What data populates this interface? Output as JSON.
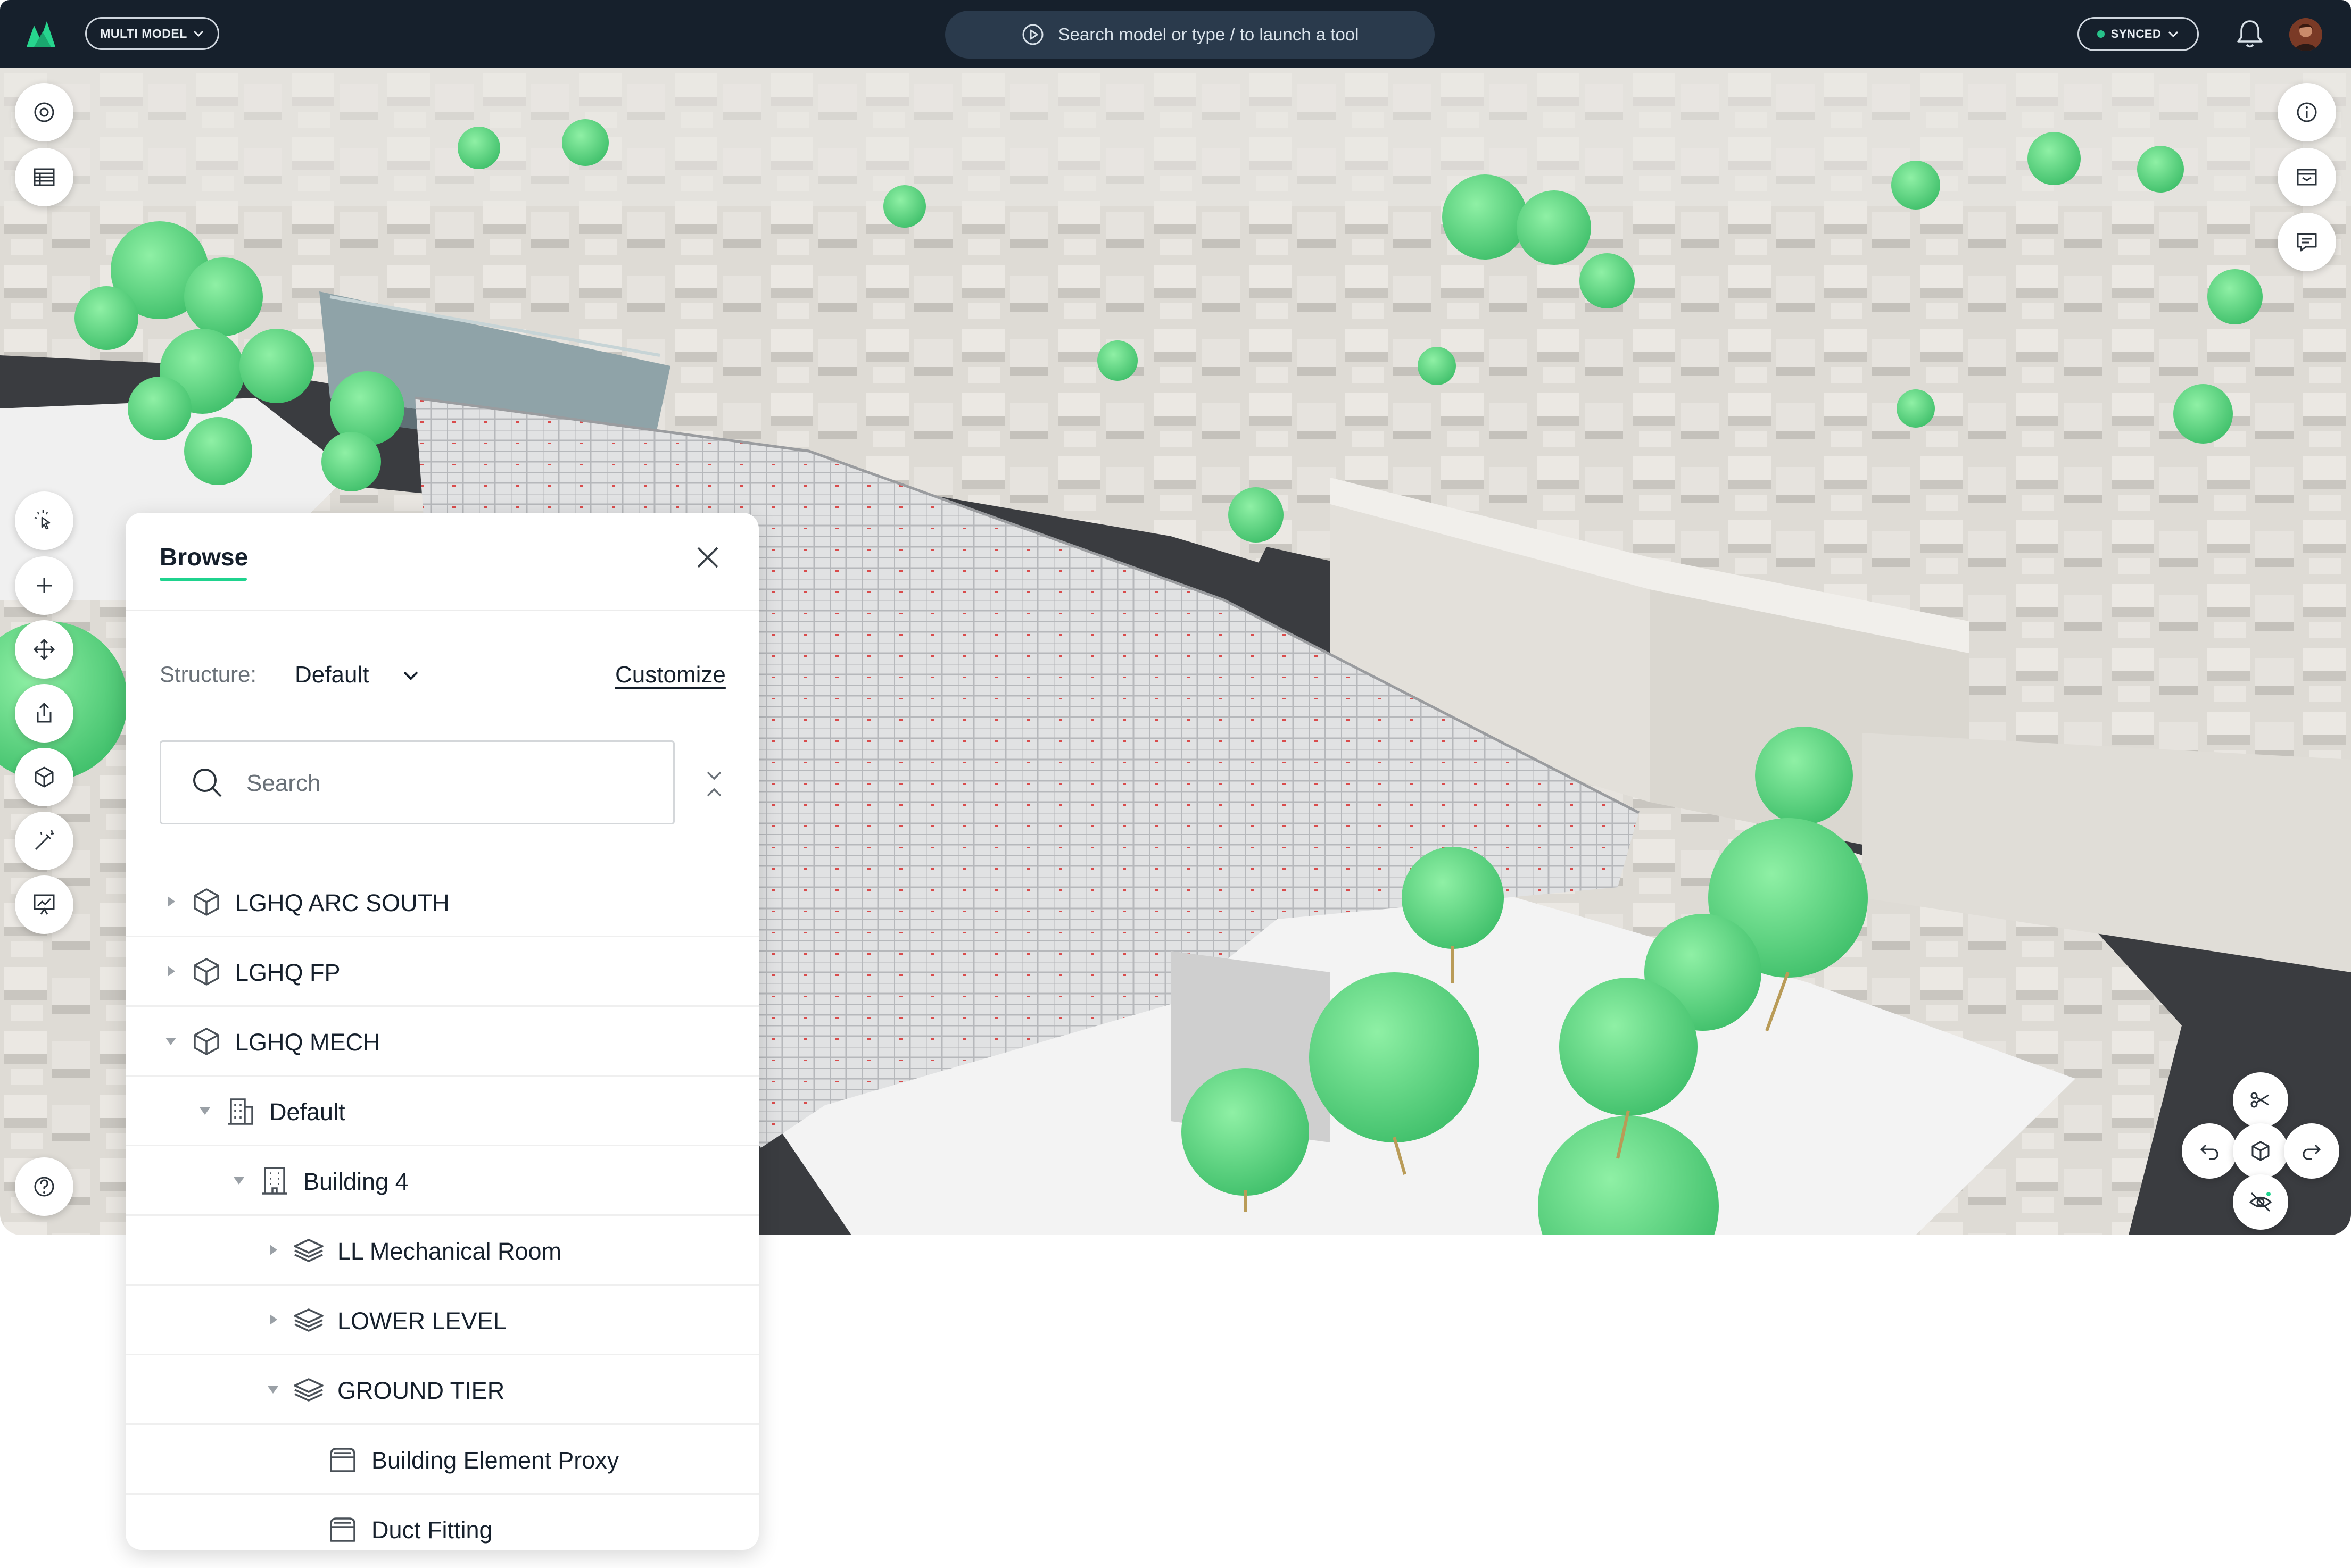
{
  "topbar": {
    "model_switch_label": "MULTI MODEL",
    "search_placeholder": "Search model or type / to launch a tool",
    "sync_label": "SYNCED"
  },
  "left_tools": [
    "search-target-icon",
    "table-icon",
    "select-icon",
    "add-icon",
    "move-icon",
    "export-icon",
    "model-icon",
    "wand-icon",
    "presentation-icon",
    "help-icon"
  ],
  "right_tools": [
    "info-icon",
    "inbox-icon",
    "comment-icon"
  ],
  "nav_controls": [
    "scissors-icon",
    "undo-icon",
    "cube-view-icon",
    "redo-icon",
    "hide-icon"
  ],
  "browse": {
    "title": "Browse",
    "structure_label": "Structure:",
    "structure_value": "Default",
    "customize_label": "Customize",
    "search_placeholder": "Search",
    "tree": [
      {
        "label": "LGHQ ARC SOUTH",
        "level": 0,
        "expanded": false,
        "icon": "model-cube-icon"
      },
      {
        "label": "LGHQ FP",
        "level": 0,
        "expanded": false,
        "icon": "model-cube-icon"
      },
      {
        "label": "LGHQ MECH",
        "level": 0,
        "expanded": true,
        "icon": "model-cube-icon"
      },
      {
        "label": "Default",
        "level": 1,
        "expanded": true,
        "icon": "site-icon"
      },
      {
        "label": "Building 4",
        "level": 2,
        "expanded": true,
        "icon": "building-icon"
      },
      {
        "label": "LL Mechanical Room",
        "level": 3,
        "expanded": false,
        "icon": "layers-icon"
      },
      {
        "label": "LOWER LEVEL",
        "level": 3,
        "expanded": false,
        "icon": "layers-icon"
      },
      {
        "label": "GROUND TIER",
        "level": 3,
        "expanded": true,
        "icon": "layers-icon"
      },
      {
        "label": "Building Element Proxy",
        "level": 4,
        "expanded": null,
        "icon": "element-icon"
      },
      {
        "label": "Duct Fitting",
        "level": 4,
        "expanded": null,
        "icon": "element-icon"
      }
    ]
  },
  "colors": {
    "topbar": "#16202c",
    "accent_green": "#1fd38e",
    "tree_green": "#69d985",
    "building_gray": "#dcd9d3",
    "road": "#3a3c40"
  }
}
